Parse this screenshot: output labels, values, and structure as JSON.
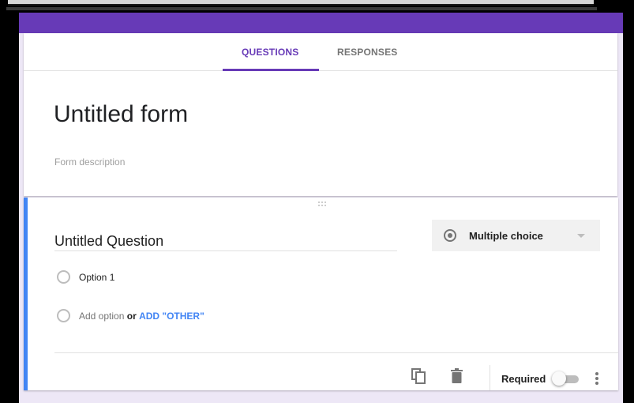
{
  "tabs": {
    "questions": "QUESTIONS",
    "responses": "RESPONSES"
  },
  "form": {
    "title": "Untitled form",
    "description_placeholder": "Form description"
  },
  "question": {
    "title": "Untitled Question",
    "type": "Multiple choice",
    "options": [
      "Option 1"
    ],
    "add_option": "Add option",
    "or": "or",
    "add_other": "ADD \"OTHER\"",
    "required_label": "Required",
    "required_on": false
  },
  "icons": {
    "drag": "drag-handle-icon",
    "type": "radio-icon",
    "dropdown": "dropdown-caret-icon",
    "copy": "copy-icon",
    "delete": "trash-icon",
    "more": "more-vert-icon"
  },
  "colors": {
    "accent": "#673ab7",
    "background": "#ede7f6",
    "link": "#4285f4",
    "active_border": "#4285f4"
  }
}
